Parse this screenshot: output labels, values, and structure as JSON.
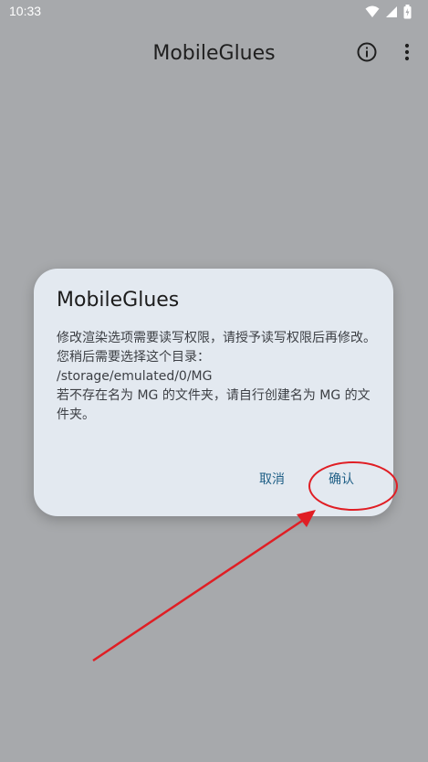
{
  "status_bar": {
    "time": "10:33",
    "icons": [
      "wifi-icon",
      "signal-icon",
      "battery-icon"
    ]
  },
  "app_bar": {
    "title": "MobileGlues",
    "actions": [
      "info-icon",
      "more-vert-icon"
    ]
  },
  "dialog": {
    "title": "MobileGlues",
    "message": "修改渲染选项需要读写权限，请授予读写权限后再修改。\n您稍后需要选择这个目录：\n/storage/emulated/0/MG\n若不存在名为 MG 的文件夹，请自行创建名为 MG 的文件夹。",
    "cancel_label": "取消",
    "confirm_label": "确认"
  },
  "annotation": {
    "color": "#e01e24"
  },
  "colors": {
    "scrim": "#a7a9ac",
    "dialog_bg": "#e3e9f0",
    "button_text": "#1f5f86"
  }
}
